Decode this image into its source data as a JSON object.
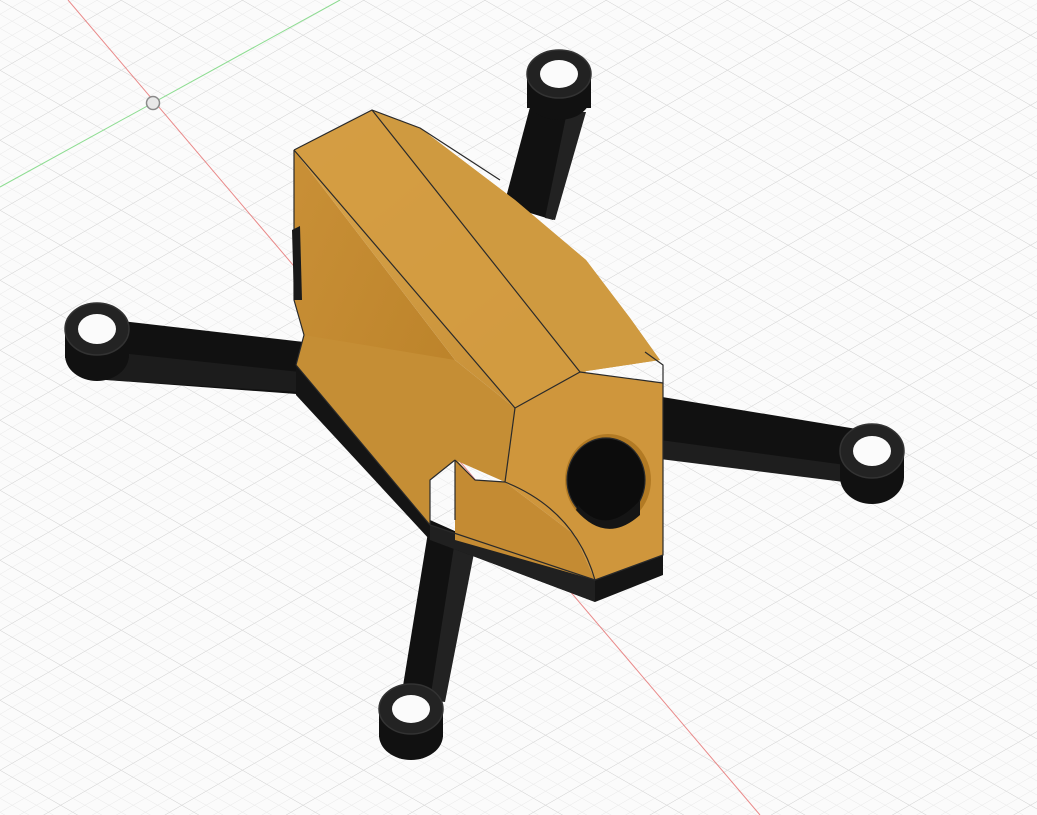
{
  "viewport": {
    "view": "isometric",
    "grid_visible": true,
    "colors": {
      "background": "#fbfbfb",
      "grid_minor": "#e6e6e6",
      "grid_major": "#cfcfcf",
      "x_axis": "#e05858",
      "y_axis": "#5fcf6a",
      "body_light": "#d8a24a",
      "body_mid": "#c89036",
      "body_dark": "#b57d27",
      "arm": "#111111",
      "arm_edge": "#333333"
    },
    "model": {
      "parts": [
        "drone-frame-body",
        "drone-frame-arms",
        "camera-hole"
      ]
    }
  }
}
